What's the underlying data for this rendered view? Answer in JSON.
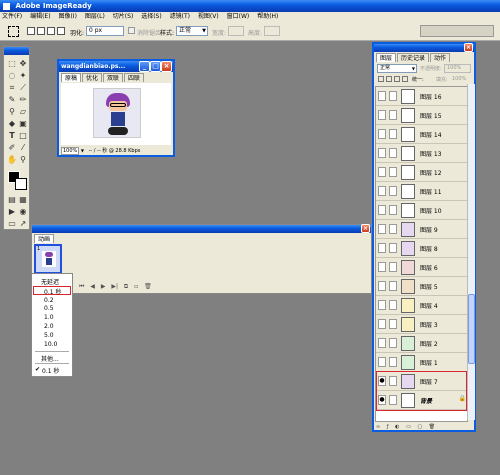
{
  "app_title": "Adobe ImageReady",
  "menubar": [
    "文件(F)",
    "编辑(E)",
    "图像(I)",
    "图层(L)",
    "切片(S)",
    "选择(S)",
    "滤镜(T)",
    "视图(V)",
    "窗口(W)",
    "帮助(H)"
  ],
  "options": {
    "feather_label": "羽化:",
    "feather_value": "0 px",
    "antialias": "消除锯齿",
    "style_label": "样式:",
    "style_value": "正常",
    "width_label": "宽度:",
    "height_label": "高度:"
  },
  "doc": {
    "title": "wangdianbiao.ps...",
    "tabs": [
      "原稿",
      "优化",
      "双联",
      "四联"
    ],
    "zoom": "100%",
    "status": "-- / -- 秒 @ 28.8 Kbps"
  },
  "animation": {
    "title": "动画",
    "frame_no": "1",
    "frame_time": "0 秒",
    "time_menu": [
      "无延迟",
      "0.1 秒",
      "0.2",
      "0.5",
      "1.0",
      "2.0",
      "5.0",
      "10.0",
      "其他...",
      "0.1 秒"
    ]
  },
  "layers": {
    "tabs": [
      "图层",
      "历史记录",
      "动作"
    ],
    "blend": "正常",
    "opacity_label": "不透明度:",
    "opacity": "100%",
    "unify_label": "统一:",
    "fill_label": "填充:",
    "fill": "100%",
    "rows": [
      "图层 16",
      "图层 15",
      "图层 14",
      "图层 13",
      "图层 12",
      "图层 11",
      "图层 10",
      "图层 9",
      "图层 8",
      "图层 6",
      "图层 5",
      "图层 4",
      "图层 3",
      "图层 2",
      "图层 1",
      "图层 7",
      "背景"
    ]
  },
  "colors": {
    "highlight": "#d9262e",
    "xp_blue": "#0a5de0"
  }
}
